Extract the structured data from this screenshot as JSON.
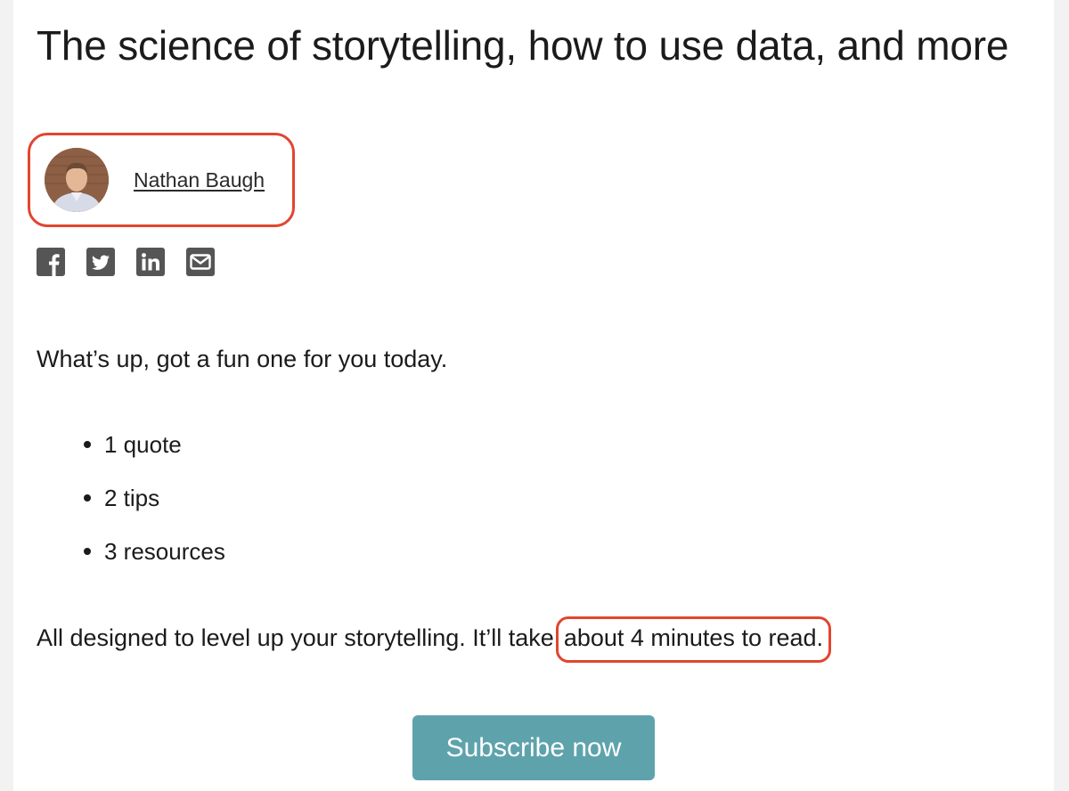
{
  "post": {
    "title": "The science of storytelling, how to use data, and more",
    "author": "Nathan Baugh",
    "intro": "What’s up, got a fun one for you today.",
    "bullets": [
      "1 quote",
      "2 tips",
      "3 resources"
    ],
    "summary_lead": "All designed to level up your storytelling. It’ll take",
    "summary_highlight": "about 4 minutes to read."
  },
  "share": {
    "icons": [
      "facebook-icon",
      "twitter-icon",
      "linkedin-icon",
      "email-icon"
    ]
  },
  "cta": {
    "subscribe_label": "Subscribe now"
  },
  "colors": {
    "annotation": "#e2452f",
    "button": "#5ea3ac",
    "icon": "#555555"
  }
}
